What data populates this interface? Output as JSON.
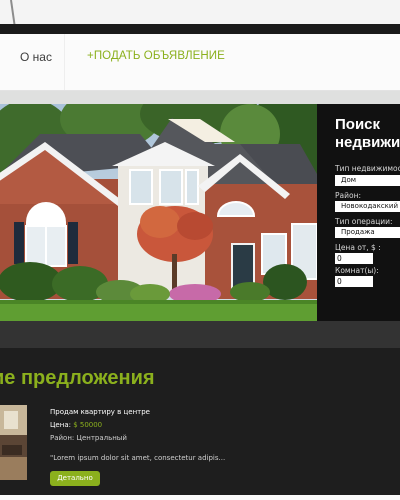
{
  "nav": {
    "about": "О нас",
    "post_ad": "+ПОДАТЬ ОБЪЯВЛЕНИЕ"
  },
  "search": {
    "title": "Поиск\nнедвижим",
    "property_type_label": "Тип недвижимост",
    "property_type_value": "Дом",
    "district_label": "Район:",
    "district_value": "Новокодакский",
    "operation_label": "Тип операции:",
    "operation_value": "Продажа",
    "price_label": "Цена от, $ :",
    "price_value": "0",
    "rooms_label": "Комнат(ы):",
    "rooms_value": "0"
  },
  "offers": {
    "heading": "ие предложения",
    "listing": {
      "title": "Продам квартиру в центре",
      "price_label": "Цена:",
      "price_value": " $ 50000",
      "district": "Район: Центральный",
      "description": "\"Lorem ipsum dolor sit amet, consectetur adipis...",
      "details_button": "Детально"
    }
  },
  "colors": {
    "accent": "#8bb01d",
    "panel": "#111111",
    "page_bg": "#1e1e1e"
  }
}
